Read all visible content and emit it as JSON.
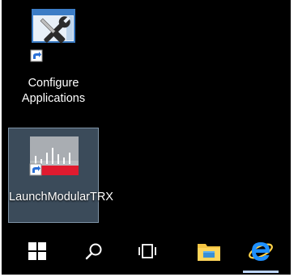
{
  "desktop": {
    "icons": [
      {
        "label": "Configure Applications",
        "icon": "configure-tools-icon",
        "shortcut": true
      },
      {
        "label": "LaunchModularTRX",
        "icon": "modular-trx-icon",
        "shortcut": true,
        "selected": true
      }
    ]
  },
  "taskbar": {
    "buttons": [
      {
        "icon": "windows-start-icon"
      },
      {
        "icon": "search-icon"
      },
      {
        "icon": "task-view-icon"
      },
      {
        "icon": "file-explorer-icon"
      },
      {
        "icon": "internet-explorer-icon",
        "active": true
      }
    ]
  },
  "colors": {
    "desktop_background": "#000000",
    "selection_fill": "#3b4b5a",
    "selection_border": "#7f93a6",
    "explorer_yellow": "#f5c542",
    "ie_blue": "#1e90ff",
    "trx_red": "#e01b2f"
  }
}
